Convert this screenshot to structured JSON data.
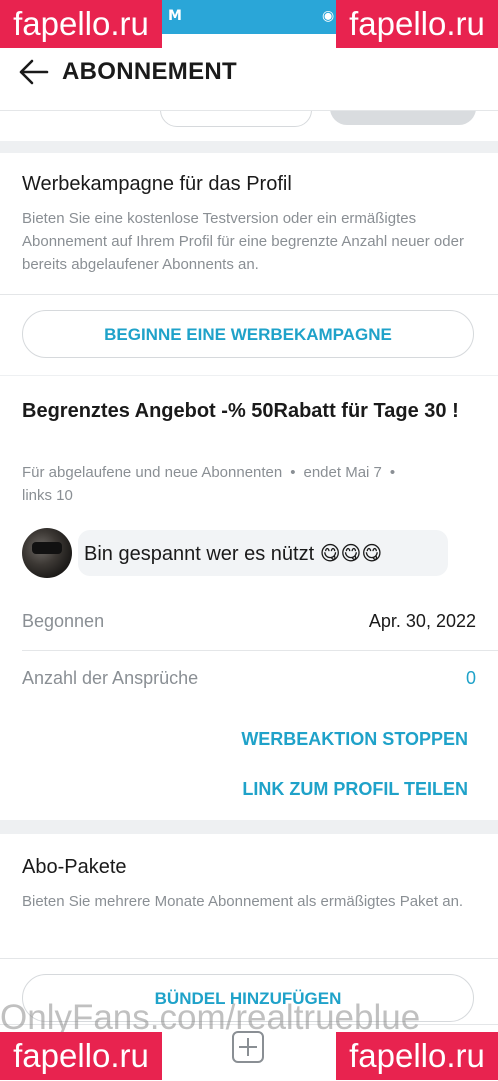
{
  "header": {
    "title": "ABONNEMENT"
  },
  "promo_campaign": {
    "title": "Werbekampagne für das Profil",
    "description": "Bieten Sie eine kostenlose Testversion oder ein ermäßigtes Abonnement auf Ihrem Profil für eine begrenzte Anzahl neuer oder bereits abgelaufener Abonnents an.",
    "button_label": "BEGINNE EINE WERBEKAMPAGNE"
  },
  "offer": {
    "title": "Begrenztes Angebot -% 50Rabatt für Tage 30 !",
    "audience": "Für abgelaufene und neue Abonnenten",
    "ends": "endet Mai 7",
    "links": "links 10",
    "comment_text": "Bin gespannt wer es nützt",
    "comment_emojis": "😋😋😋",
    "started_label": "Begonnen",
    "started_value": "Apr. 30, 2022",
    "claims_label": "Anzahl der Ansprüche",
    "claims_value": "0",
    "stop_label": "WERBEAKTION STOPPEN",
    "share_label": "LINK ZUM PROFIL TEILEN"
  },
  "bundles": {
    "title": "Abo-Pakete",
    "description": "Bieten Sie mehrere Monate Abonnement als ermäßigtes Paket an.",
    "button_label": "BÜNDEL HINZUFÜGEN"
  },
  "watermarks": {
    "badge": "fapello.ru",
    "bottom_text": "OnlyFans.com/realtrueblue"
  },
  "status_bar": {
    "m_icon": "M",
    "eye_icon": "◉"
  },
  "colors": {
    "accent": "#1fa2c9",
    "watermark_badge": "#e8234f",
    "status_bar": "#2aa6d8"
  }
}
